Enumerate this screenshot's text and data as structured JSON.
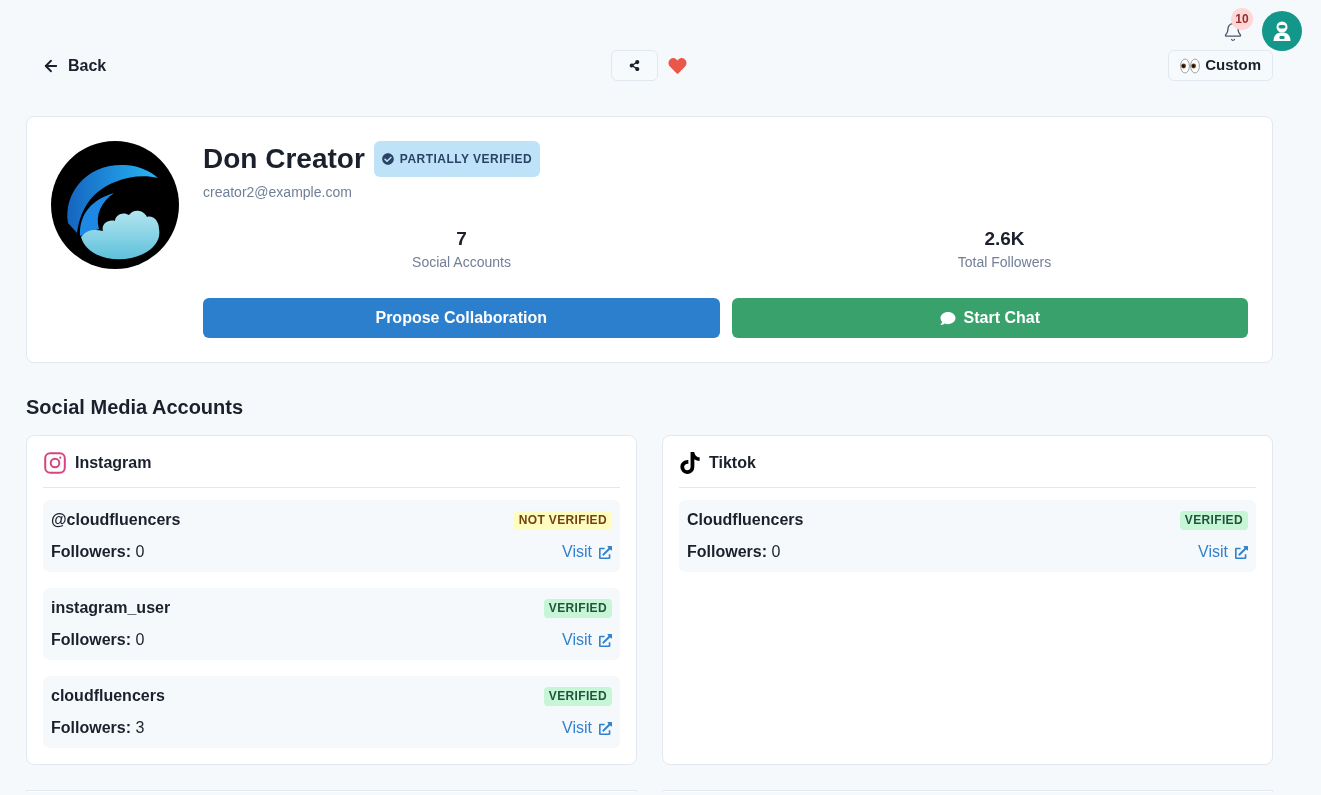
{
  "top_bar": {
    "notification_count": "10"
  },
  "nav": {
    "back": "Back",
    "favorite": true,
    "view_button": "Custom"
  },
  "profile": {
    "name": "Don Creator",
    "verification": {
      "label": "PARTIALLY VERIFIED",
      "kind": "partial"
    },
    "email": "creator2@example.com",
    "stats": [
      {
        "value": "7",
        "label": "Social Accounts"
      },
      {
        "value": "2.6K",
        "label": "Total Followers"
      }
    ],
    "actions": [
      {
        "label": "Propose Collaboration",
        "kind": "primary"
      },
      {
        "label": "Start Chat",
        "kind": "chat"
      }
    ]
  },
  "social_section": {
    "title": "Social Media Accounts",
    "platforms": [
      {
        "name": "Instagram",
        "kind": "instagram",
        "accounts": [
          {
            "handle": "@cloudfluencers",
            "status": {
              "label": "NOT VERIFIED",
              "kind": "unverified"
            },
            "followers": "**Followers:** 0",
            "link": "Visit"
          },
          {
            "handle": "instagram_user",
            "status": {
              "label": "VERIFIED",
              "kind": "verified"
            },
            "followers": "**Followers:** 0",
            "link": "Visit"
          },
          {
            "handle": "cloudfluencers",
            "status": {
              "label": "VERIFIED",
              "kind": "verified"
            },
            "followers": "**Followers:** 3",
            "link": "Visit"
          }
        ]
      },
      {
        "name": "Tiktok",
        "kind": "tiktok",
        "accounts": [
          {
            "handle": "Cloudfluencers",
            "status": {
              "label": "VERIFIED",
              "kind": "verified"
            },
            "followers": "**Followers:** 0",
            "link": "Visit"
          }
        ]
      }
    ]
  }
}
